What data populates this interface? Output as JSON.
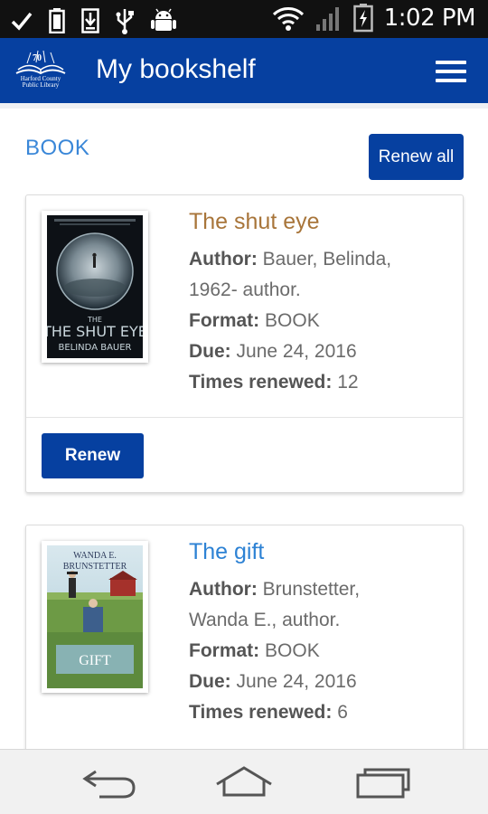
{
  "status_bar": {
    "time": "1:02 PM",
    "icons": [
      "check-icon",
      "battery-saver-icon",
      "download-icon",
      "usb-icon",
      "android-icon",
      "wifi-icon",
      "signal-icon",
      "battery-icon"
    ]
  },
  "app_bar": {
    "title": "My bookshelf",
    "logo_number": "70",
    "logo_text": [
      "Harford County",
      "Public Library"
    ],
    "menu_icon": "hamburger-menu-icon"
  },
  "section": {
    "title": "BOOK",
    "renew_all_label": "Renew all"
  },
  "books": [
    {
      "title": "The shut eye",
      "author_label": "Author:",
      "author_line1": "Bauer, Belinda,",
      "author_line2": "1962- author.",
      "format_label": "Format:",
      "format": "BOOK",
      "due_label": "Due:",
      "due": "June 24, 2016",
      "renewed_label": "Times renewed:",
      "renewed": "12",
      "renew_label": "Renew",
      "cover_title": "THE SHUT EYE",
      "cover_author": "BELINDA BAUER"
    },
    {
      "title": "The gift",
      "author_label": "Author:",
      "author_line1": "Brunstetter,",
      "author_line2": "Wanda E., author.",
      "format_label": "Format:",
      "format": "BOOK",
      "due_label": "Due:",
      "due": "June 24, 2016",
      "renewed_label": "Times renewed:",
      "renewed": "6",
      "cover_author_line1": "WANDA E.",
      "cover_author_line2": "BRUNSTETTER",
      "cover_title": "GIFT"
    }
  ],
  "nav_bar": {
    "icons": [
      "back-icon",
      "home-icon",
      "recent-apps-icon"
    ]
  },
  "colors": {
    "app_bar": "#0640a0",
    "section_title": "#3a87d8",
    "title_orange": "#a8753a",
    "title_blue": "#2d82d4"
  }
}
